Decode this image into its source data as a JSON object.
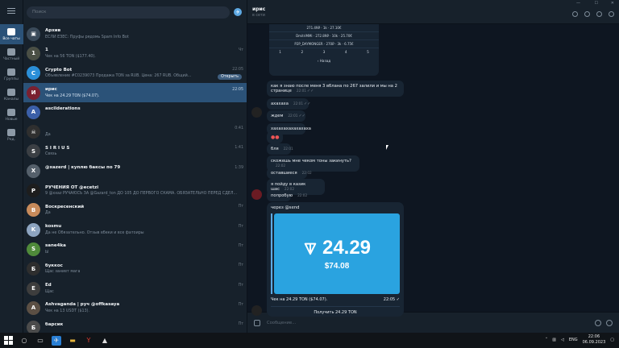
{
  "search": {
    "placeholder": "Поиск"
  },
  "rail": [
    {
      "label": "Все чаты",
      "icon": "chats-icon",
      "active": true
    },
    {
      "label": "Частный",
      "icon": "person-icon",
      "active": false
    },
    {
      "label": "Группы",
      "icon": "group-icon",
      "active": false
    },
    {
      "label": "Каналы",
      "icon": "megaphone-icon",
      "active": false
    },
    {
      "label": "Новые",
      "icon": "chat-bubble-icon",
      "active": false
    },
    {
      "label": "Ред.",
      "icon": "sliders-icon",
      "active": false
    }
  ],
  "chats": [
    {
      "name": "Архив",
      "preview": "ЕСЛИ ЕЗЕС: Пруфы рядомь Spam Info Bot",
      "time": "",
      "color": "#3a4a5a",
      "initial": "▣"
    },
    {
      "name": "1",
      "preview": "Чек на 56 TON ($177.40).",
      "time": "Чт",
      "color": "#4a4f45",
      "initial": "1"
    },
    {
      "name": "Crypto Bot",
      "preview": "Объявление #C0239073 Продажа TON за RUB. Цена: 267 RUB. Общий...",
      "time": "22:05",
      "color": "#2b8fd8",
      "initial": "C",
      "action": "Открыть"
    },
    {
      "name": "ирис",
      "preview": "Чек на 24.29 TON ($74.07).",
      "time": "22:05",
      "color": "#7a2030",
      "initial": "И"
    },
    {
      "name": "ascilderations",
      "preview": "",
      "time": "",
      "color": "#3b5fa8",
      "initial": "A"
    },
    {
      "name": "",
      "preview": "Да",
      "time": "0:41",
      "color": "#2f2f2f",
      "initial": "☠"
    },
    {
      "name": "S I R I U S",
      "preview": "Связь",
      "time": "1:41",
      "color": "#3b3f44",
      "initial": "S"
    },
    {
      "name": "@xazerd | куплю баксы по 79",
      "preview": "",
      "time": "1:39",
      "color": "#55606b",
      "initial": "X"
    },
    {
      "name": "РУЧЕНИЯ ОТ @ecetzi",
      "preview": "9 @xxaz РУЧАЮСЬ ЗА @Gazard_ton ДО 105 ДО ПЕРВОГО СКАМА. ОБЯЗАТЕЛЬНО ПЕРЕД СДЕЛ...",
      "time": "",
      "color": "#1d1d1d",
      "initial": "Р"
    },
    {
      "name": "Воскресенский",
      "preview": "Да",
      "time": "Пт",
      "color": "#c78a5a",
      "initial": "В"
    },
    {
      "name": "kosmu",
      "preview": "Да не Обязательно. Отзыв вбеки и все фатоиры",
      "time": "Пт",
      "color": "#8da4c0",
      "initial": "K"
    },
    {
      "name": "sane4ka",
      "preview": "Ы",
      "time": "Пт",
      "color": "#4f8a3a",
      "initial": "S"
    },
    {
      "name": "буккос",
      "preview": "Щас заниет мага",
      "time": "Пт",
      "color": "#2e2e2e",
      "initial": "Б"
    },
    {
      "name": "Ed",
      "preview": "Щас",
      "time": "Пт",
      "color": "#3d3d3d",
      "initial": "E"
    },
    {
      "name": "Ashvaganda | руч @offkasaya",
      "preview": "Чек на 13 USDT ($13).",
      "time": "Пт",
      "color": "#5b4f44",
      "initial": "A"
    },
    {
      "name": "барсик",
      "preview": "",
      "time": "Пт",
      "color": "#4b4b4b",
      "initial": "Б"
    }
  ],
  "conversation": {
    "title": "ирис",
    "status": "в сети",
    "keyboard": {
      "lines": [
        "271.49₽ · 1k · 27.10€",
        "DmitriMMi · 272.89₽ · 10k · 25.70€",
        "P2P_DAYMONGER · 270₽ · 3k · 6.75€"
      ],
      "pages": [
        "1",
        "2",
        "3",
        "4",
        "5"
      ],
      "back": "‹ Назад"
    },
    "messages": [
      {
        "text": "как я знаю после меня 3 вблана по 267 залили и мы на 2 страницe",
        "time": "22:01"
      },
      {
        "text": "ахахаха",
        "time": "22:01"
      },
      {
        "text": "ждем",
        "time": "22:01"
      },
      {
        "text": "хахахахахахахаха",
        "time": ""
      },
      {
        "text": "",
        "time": ""
      },
      {
        "text": "бля",
        "time": "22:01"
      },
      {
        "text": "скожешь мне чеком тоны закинуть?",
        "time": "22:02"
      },
      {
        "text": "оставшиеся",
        "time": "22:02"
      },
      {
        "text": "я пойду в казик щас",
        "time": "22:02"
      },
      {
        "text": "попробую",
        "time": "22:02"
      }
    ],
    "check": {
      "title": "через @send",
      "amount": "24.29",
      "usd": "$74.08",
      "caption": "Чек на 24.29 TON ($74.07).",
      "time": "22:05",
      "button": "Получить 24.29 TON"
    },
    "composer_placeholder": "Сообщение..."
  },
  "taskbar": {
    "lang": "ENG",
    "time": "22:06",
    "date": "06.09.2023"
  },
  "colors": {
    "accent": "#2b5278",
    "ton_blue": "#2aa3e0",
    "bubble": "#182533"
  }
}
